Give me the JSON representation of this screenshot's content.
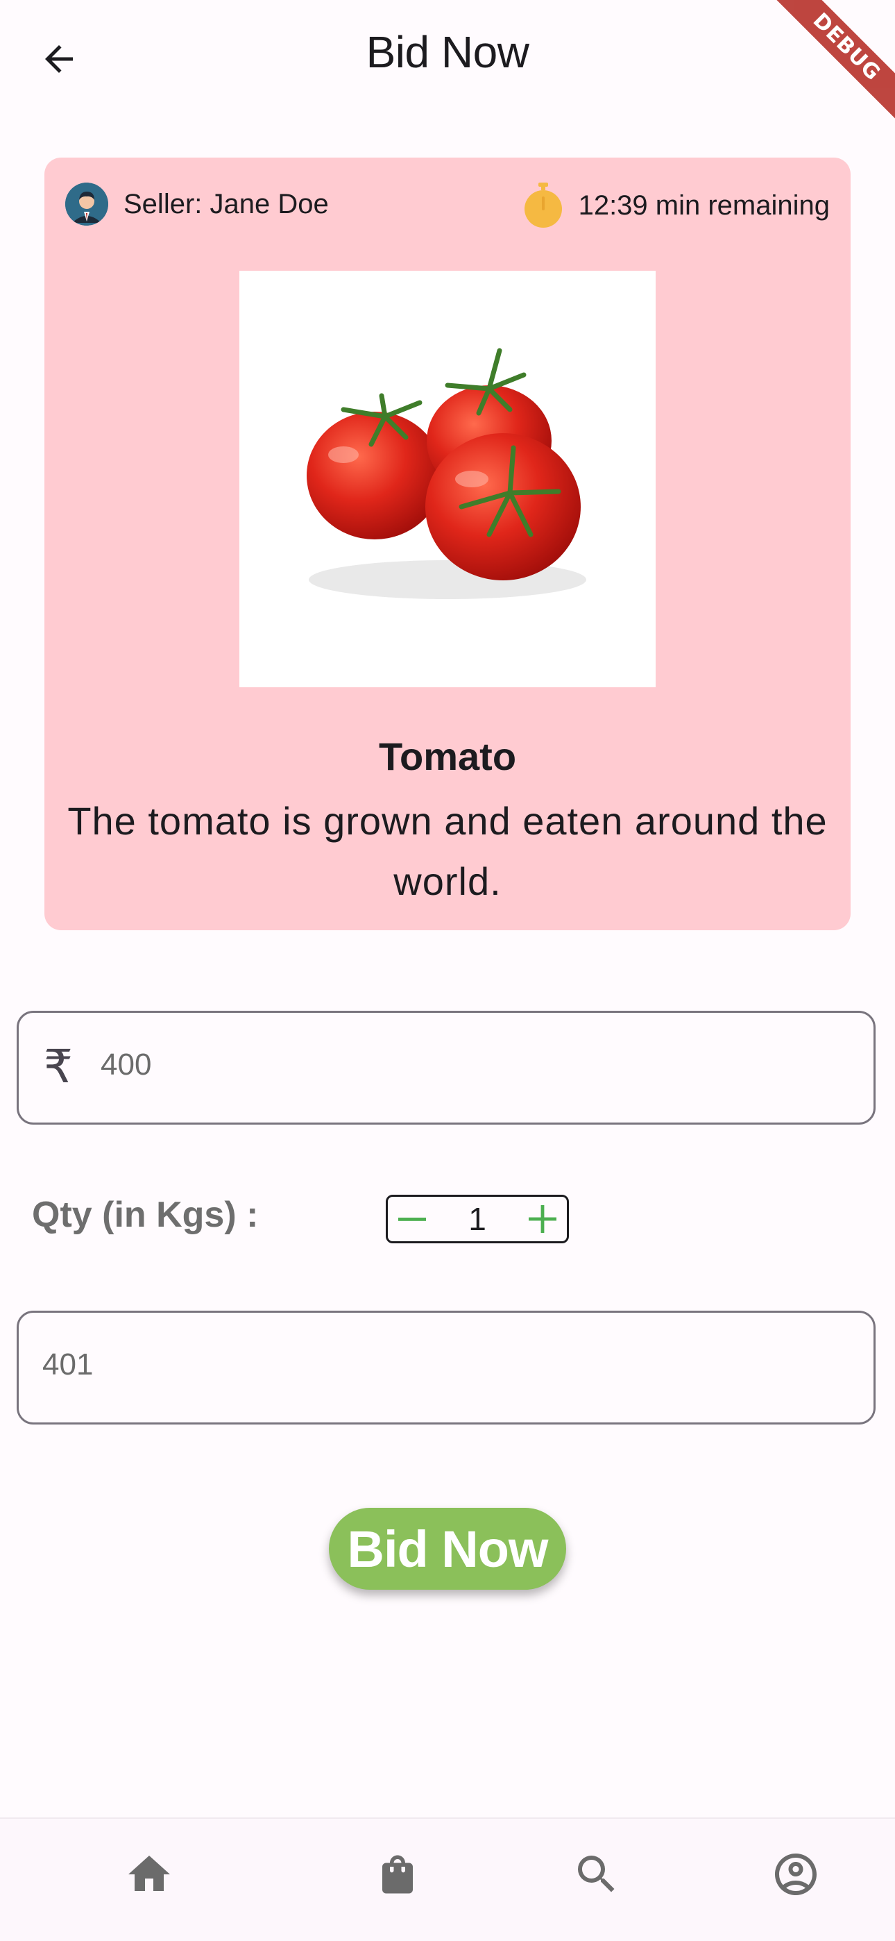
{
  "app_bar": {
    "title": "Bid Now",
    "back_icon": "arrow-back-icon",
    "debug_banner": "DEBUG"
  },
  "card": {
    "background": "#ffcbd1",
    "seller_label": "Seller: Jane Doe",
    "timer_text": "12:39 min remaining",
    "timer_color": "#f5b942",
    "product_name": "Tomato",
    "product_description": "The tomato is  grown and eaten around the world."
  },
  "bid_form": {
    "currency_icon": "rupee-icon",
    "currency_symbol": "₹",
    "price_value": "400",
    "qty_label": "Qty (in Kgs) :",
    "qty_value": "1",
    "total_value": "401",
    "accent_color": "#4caf50",
    "bid_button_label": "Bid Now",
    "bid_button_color": "#8bc05a"
  },
  "bottom_nav": {
    "items": [
      {
        "icon": "home-icon",
        "color": "#6b6b6b"
      },
      {
        "icon": "shopping-bag-icon",
        "color": "#6b6b6b"
      },
      {
        "icon": "search-icon",
        "color": "#6b6b6b"
      },
      {
        "icon": "account-circle-icon",
        "color": "#6b6b6b"
      }
    ]
  }
}
